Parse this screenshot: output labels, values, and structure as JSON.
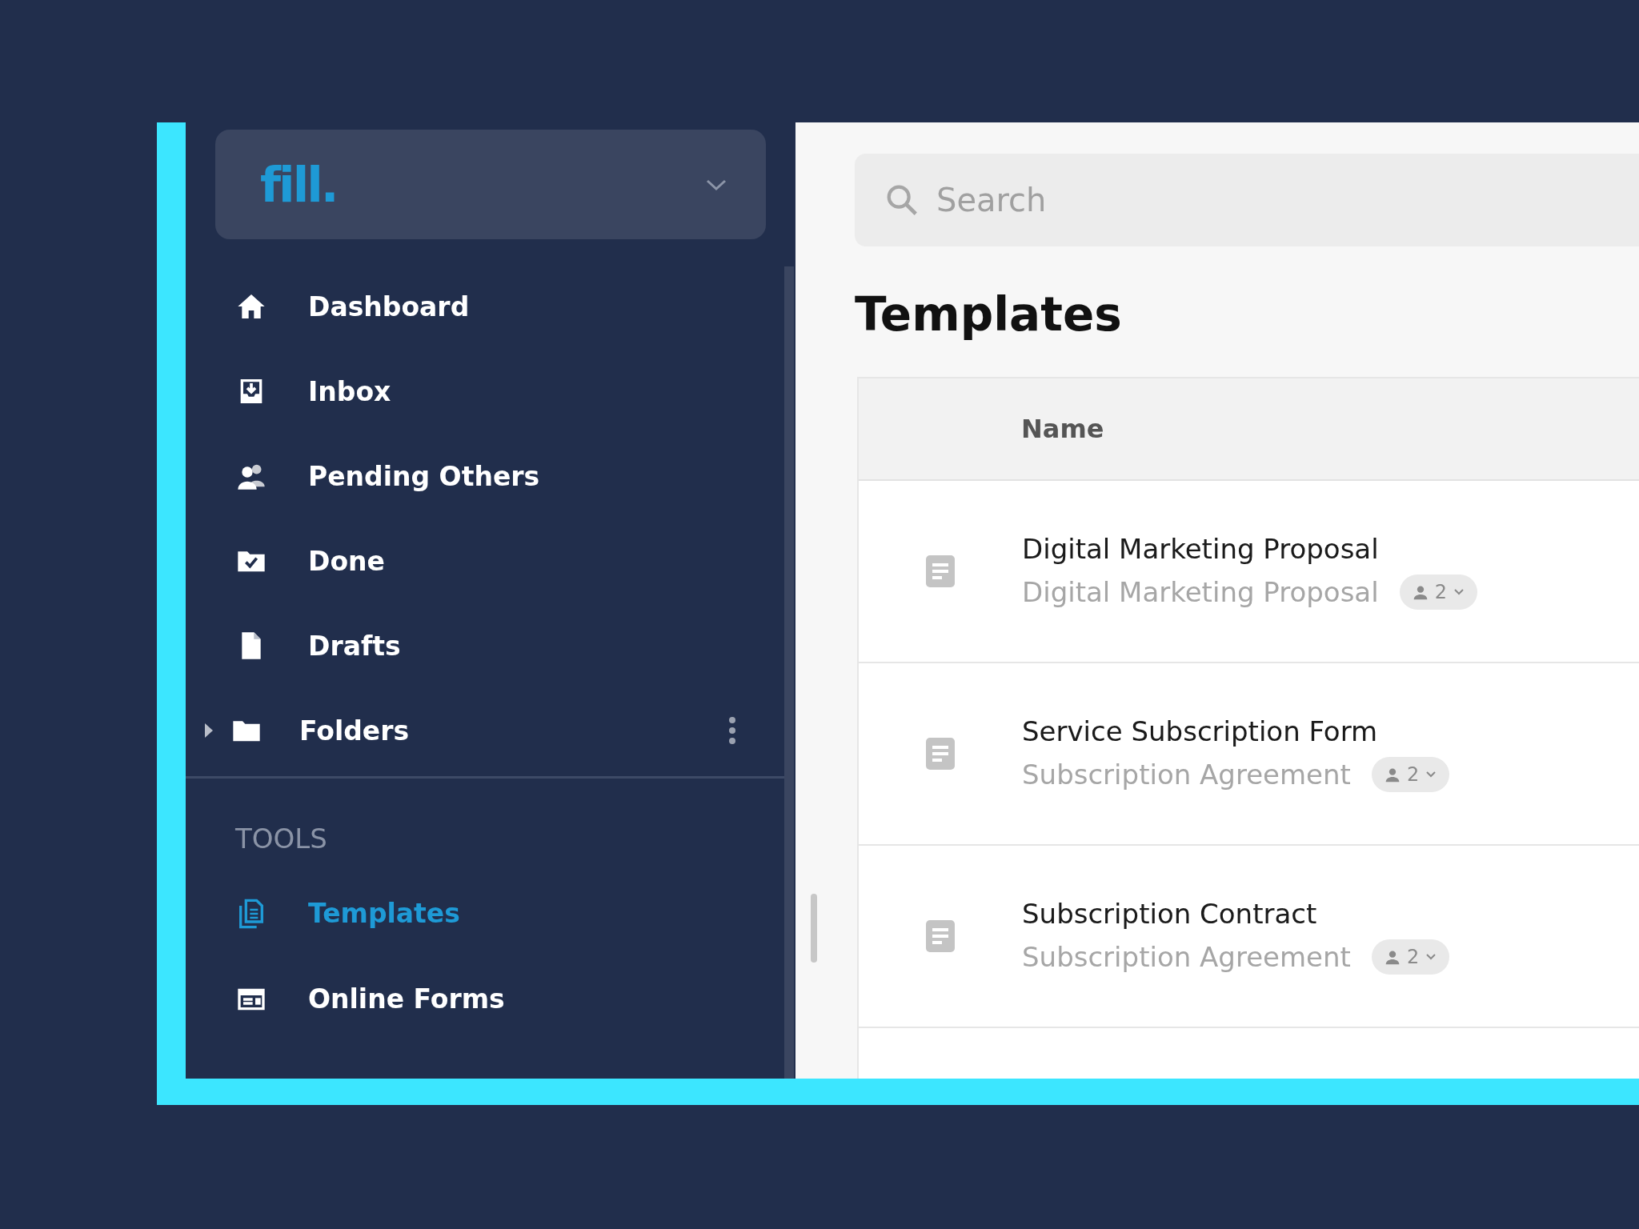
{
  "logo": {
    "text": "fill."
  },
  "nav": [
    {
      "label": "Dashboard",
      "kind": "home",
      "selected": false
    },
    {
      "label": "Inbox",
      "kind": "inbox",
      "selected": false
    },
    {
      "label": "Pending Others",
      "kind": "users",
      "selected": false
    },
    {
      "label": "Done",
      "kind": "done",
      "selected": false
    },
    {
      "label": "Drafts",
      "kind": "file",
      "selected": false
    }
  ],
  "folders": {
    "label": "Folders",
    "expanded": false
  },
  "tools": {
    "heading": "TOOLS",
    "items": [
      {
        "label": "Templates",
        "kind": "templates",
        "selected": true
      },
      {
        "label": "Online Forms",
        "kind": "forms",
        "selected": false
      }
    ]
  },
  "search": {
    "placeholder": "Search"
  },
  "page_title": "Templates",
  "table": {
    "columns": [
      "Name"
    ],
    "rows": [
      {
        "title": "Digital Marketing Proposal",
        "subtitle": "Digital Marketing Proposal",
        "signers": "2"
      },
      {
        "title": "Service Subscription Form",
        "subtitle": "Subscription Agreement",
        "signers": "2"
      },
      {
        "title": "Subscription Contract",
        "subtitle": "Subscription Agreement",
        "signers": "2"
      }
    ]
  }
}
